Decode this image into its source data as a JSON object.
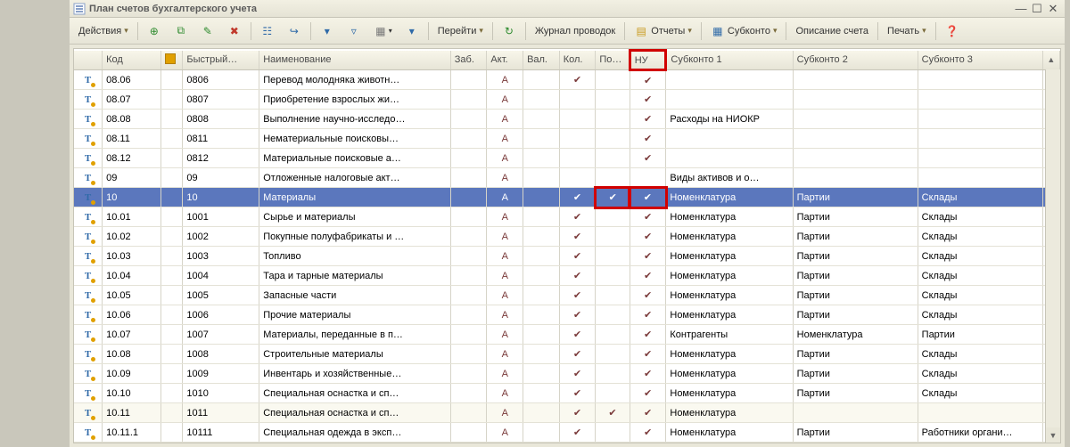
{
  "window": {
    "title": "План счетов бухгалтерского учета"
  },
  "toolbar": {
    "actions": "Действия",
    "go": "Перейти",
    "journal": "Журнал проводок",
    "reports": "Отчеты",
    "subconto": "Субконто",
    "description": "Описание счета",
    "print": "Печать"
  },
  "columns": {
    "icon": "",
    "code": "Код",
    "hier": "",
    "fast": "Быстрый…",
    "name": "Наименование",
    "zab": "Заб.",
    "act": "Акт.",
    "val": "Вал.",
    "kol": "Кол.",
    "po": "По…",
    "nu": "НУ",
    "sub1": "Субконто 1",
    "sub2": "Субконто 2",
    "sub3": "Субконто 3"
  },
  "rows": [
    {
      "code": "08.06",
      "fast": "0806",
      "name": "Перевод молодняка животн…",
      "act": "А",
      "val": "",
      "kol": "✔",
      "po": "",
      "nu": "✔",
      "s1": "",
      "s2": "",
      "s3": ""
    },
    {
      "code": "08.07",
      "fast": "0807",
      "name": "Приобретение взрослых жи…",
      "act": "А",
      "val": "",
      "kol": "",
      "po": "",
      "nu": "✔",
      "s1": "",
      "s2": "",
      "s3": ""
    },
    {
      "code": "08.08",
      "fast": "0808",
      "name": "Выполнение научно-исследо…",
      "act": "А",
      "val": "",
      "kol": "",
      "po": "",
      "nu": "✔",
      "s1": "Расходы на НИОКР",
      "s2": "",
      "s3": ""
    },
    {
      "code": "08.11",
      "fast": "0811",
      "name": "Нематериальные поисковы…",
      "act": "А",
      "val": "",
      "kol": "",
      "po": "",
      "nu": "✔",
      "s1": "",
      "s2": "",
      "s3": ""
    },
    {
      "code": "08.12",
      "fast": "0812",
      "name": "Материальные поисковые а…",
      "act": "А",
      "val": "",
      "kol": "",
      "po": "",
      "nu": "✔",
      "s1": "",
      "s2": "",
      "s3": ""
    },
    {
      "code": "09",
      "fast": "09",
      "name": "Отложенные налоговые акт…",
      "act": "А",
      "val": "",
      "kol": "",
      "po": "",
      "nu": "",
      "s1": "Виды активов и о…",
      "s2": "",
      "s3": ""
    },
    {
      "code": "10",
      "fast": "10",
      "name": "Материалы",
      "act": "А",
      "val": "",
      "kol": "✔",
      "po": "✔",
      "nu": "✔",
      "s1": "Номенклатура",
      "s2": "Партии",
      "s3": "Склады",
      "selected": true,
      "nuhl": true
    },
    {
      "code": "10.01",
      "fast": "1001",
      "name": "Сырье и материалы",
      "act": "А",
      "val": "",
      "kol": "✔",
      "po": "",
      "nu": "✔",
      "s1": "Номенклатура",
      "s2": "Партии",
      "s3": "Склады"
    },
    {
      "code": "10.02",
      "fast": "1002",
      "name": "Покупные полуфабрикаты и …",
      "act": "А",
      "val": "",
      "kol": "✔",
      "po": "",
      "nu": "✔",
      "s1": "Номенклатура",
      "s2": "Партии",
      "s3": "Склады"
    },
    {
      "code": "10.03",
      "fast": "1003",
      "name": "Топливо",
      "act": "А",
      "val": "",
      "kol": "✔",
      "po": "",
      "nu": "✔",
      "s1": "Номенклатура",
      "s2": "Партии",
      "s3": "Склады"
    },
    {
      "code": "10.04",
      "fast": "1004",
      "name": "Тара и тарные материалы",
      "act": "А",
      "val": "",
      "kol": "✔",
      "po": "",
      "nu": "✔",
      "s1": "Номенклатура",
      "s2": "Партии",
      "s3": "Склады"
    },
    {
      "code": "10.05",
      "fast": "1005",
      "name": "Запасные части",
      "act": "А",
      "val": "",
      "kol": "✔",
      "po": "",
      "nu": "✔",
      "s1": "Номенклатура",
      "s2": "Партии",
      "s3": "Склады"
    },
    {
      "code": "10.06",
      "fast": "1006",
      "name": "Прочие материалы",
      "act": "А",
      "val": "",
      "kol": "✔",
      "po": "",
      "nu": "✔",
      "s1": "Номенклатура",
      "s2": "Партии",
      "s3": "Склады"
    },
    {
      "code": "10.07",
      "fast": "1007",
      "name": "Материалы, переданные в п…",
      "act": "А",
      "val": "",
      "kol": "✔",
      "po": "",
      "nu": "✔",
      "s1": "Контрагенты",
      "s2": "Номенклатура",
      "s3": "Партии"
    },
    {
      "code": "10.08",
      "fast": "1008",
      "name": "Строительные материалы",
      "act": "А",
      "val": "",
      "kol": "✔",
      "po": "",
      "nu": "✔",
      "s1": "Номенклатура",
      "s2": "Партии",
      "s3": "Склады"
    },
    {
      "code": "10.09",
      "fast": "1009",
      "name": "Инвентарь и хозяйственные…",
      "act": "А",
      "val": "",
      "kol": "✔",
      "po": "",
      "nu": "✔",
      "s1": "Номенклатура",
      "s2": "Партии",
      "s3": "Склады"
    },
    {
      "code": "10.10",
      "fast": "1010",
      "name": "Специальная оснастка и сп…",
      "act": "А",
      "val": "",
      "kol": "✔",
      "po": "",
      "nu": "✔",
      "s1": "Номенклатура",
      "s2": "Партии",
      "s3": "Склады"
    },
    {
      "code": "10.11",
      "fast": "1011",
      "name": "Специальная оснастка и сп…",
      "act": "А",
      "val": "",
      "kol": "✔",
      "po": "✔",
      "nu": "✔",
      "s1": "Номенклатура",
      "s2": "",
      "s3": "",
      "alt": true
    },
    {
      "code": "10.11.1",
      "fast": "10111",
      "name": "Специальная одежда в эксп…",
      "act": "А",
      "val": "",
      "kol": "✔",
      "po": "",
      "nu": "✔",
      "s1": "Номенклатура",
      "s2": "Партии",
      "s3": "Работники органи…"
    }
  ]
}
